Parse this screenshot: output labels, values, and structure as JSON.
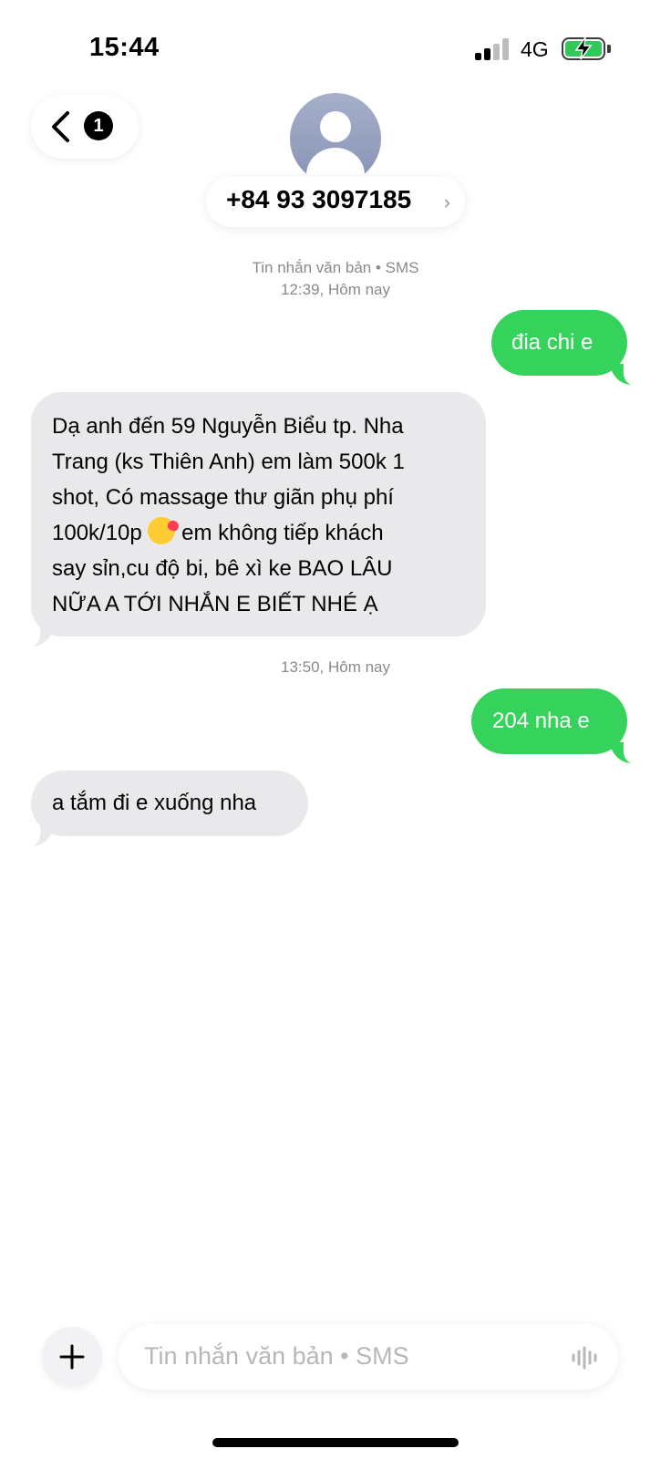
{
  "status_bar": {
    "time": "15:44",
    "network": "4G",
    "signal_bars_filled": 2,
    "signal_bars_total": 4,
    "battery_charging": true,
    "battery_color": "#34c759"
  },
  "header": {
    "back_icon": "chevron-left-icon",
    "unread_count": "1",
    "contact_number": "+84 93 3097185",
    "contact_chevron": "›",
    "avatar_icon": "person-silhouette-icon"
  },
  "conversation": {
    "meta_top_line1": "Tin nhắn văn bản • SMS",
    "meta_top_line2": "12:39, Hôm nay",
    "msg1_out": "đia chi e",
    "msg2_in_lines": [
      "Dạ anh đến 59 Nguyễn Biểu tp. Nha",
      "Trang (ks Thiên Anh) em làm 500k 1",
      "shot, Có massage thư giãn phụ phí",
      "100k/10p",
      " em không tiếp khách",
      "say sỉn,cu độ bi, bê xì ke BAO LÂU",
      "NỮA A TỚI NHẮN E BIẾT NHÉ Ạ"
    ],
    "emoji": "face-blowing-kiss-emoji",
    "meta_mid": "13:50, Hôm nay",
    "msg3_out": "204 nha e",
    "msg4_in": "a tắm đi e xuống nha",
    "colors": {
      "outgoing": "#36d35c",
      "incoming": "#e9e9eb"
    }
  },
  "composer": {
    "plus_icon": "plus-icon",
    "placeholder": "Tin nhắn văn bản • SMS",
    "audio_icon": "waveform-icon"
  }
}
